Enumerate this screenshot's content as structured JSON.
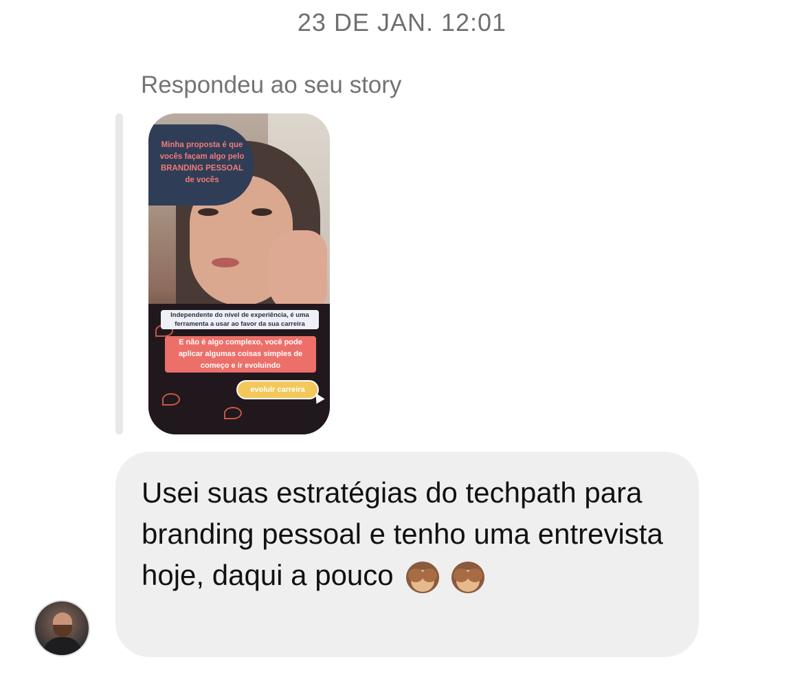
{
  "thread": {
    "timestamp": "23 DE JAN. 12:01",
    "reply_label": "Respondeu ao seu story"
  },
  "story": {
    "bubble_text": "Minha proposta é que vocês façam algo pelo BRANDING PESSOAL de vocês",
    "caption_1": "Independente do nível de experiência, é uma ferramenta a usar ao favor da sua carreira",
    "caption_2": "E não é algo complexo, você pode aplicar algumas coisas simples de começo e ir evoluindo",
    "cta_label": "evoluir carreira",
    "colors": {
      "bubble": "#2f3d57",
      "bubble_text": "#f07c74",
      "caption_red": "#ec6f69",
      "cta": "#f3c75a"
    }
  },
  "message": {
    "text": "Usei suas estratégias do techpath para branding pessoal e tenho uma entrevista hoje, daqui a pouco",
    "emoji_icons": [
      "see-no-evil-monkey-icon",
      "see-no-evil-monkey-icon"
    ],
    "bubble_color": "#efefef"
  },
  "sender": {
    "avatar_icon": "profile-photo"
  }
}
